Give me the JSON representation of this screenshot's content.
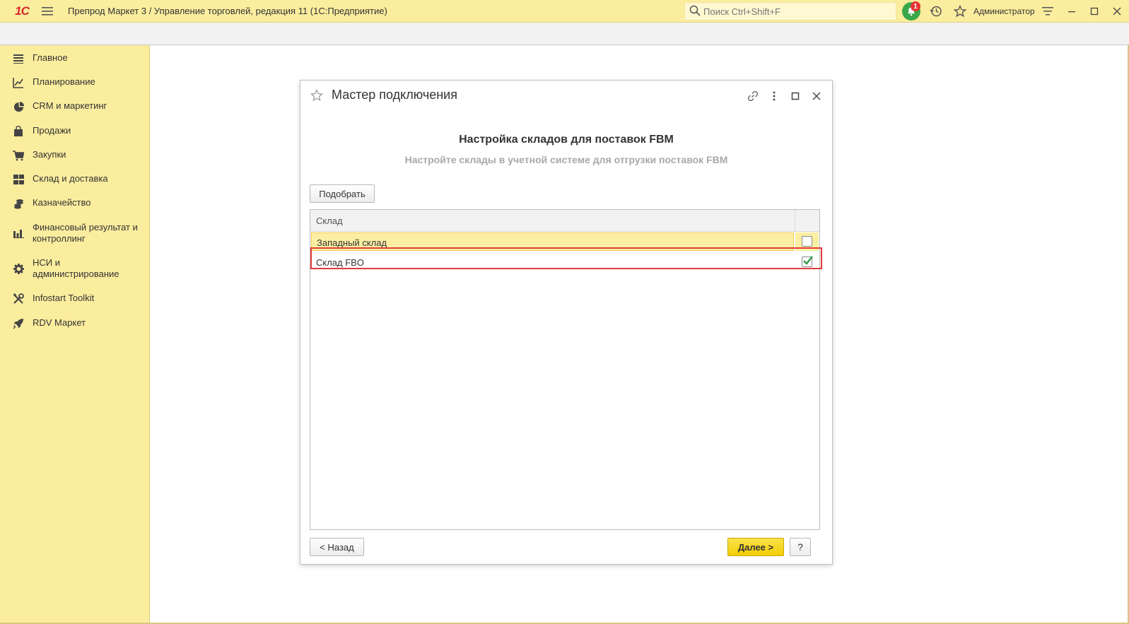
{
  "app": {
    "logo_text": "1C",
    "title": "Препрод Маркет 3 / Управление торговлей, редакция 11  (1С:Предприятие)",
    "search_placeholder": "Поиск Ctrl+Shift+F",
    "notification_count": "1",
    "user": "Администратор"
  },
  "sidebar": {
    "items": [
      {
        "label": "Главное",
        "icon": "list-icon"
      },
      {
        "label": "Планирование",
        "icon": "planning-icon"
      },
      {
        "label": "CRM и маркетинг",
        "icon": "pie-chart-icon"
      },
      {
        "label": "Продажи",
        "icon": "shopping-bag-icon"
      },
      {
        "label": "Закупки",
        "icon": "cart-icon"
      },
      {
        "label": "Склад и доставка",
        "icon": "warehouse-grid-icon"
      },
      {
        "label": "Казначейство",
        "icon": "coins-icon"
      },
      {
        "label": "Финансовый результат и\nконтроллинг",
        "icon": "bar-chart-icon"
      },
      {
        "label": "НСИ и\nадминистрирование",
        "icon": "gear-icon"
      },
      {
        "label": "Infostart Toolkit",
        "icon": "tools-icon"
      },
      {
        "label": "RDV Маркет",
        "icon": "rocket-icon"
      }
    ]
  },
  "dialog": {
    "title": "Мастер подключения",
    "step_title": "Настройка складов для поставок FBM",
    "step_subtitle": "Настройте склады в учетной системе для отгрузки поставок FBM",
    "pick_button": "Подобрать",
    "table": {
      "column_name": "Склад",
      "rows": [
        {
          "name": "Западный склад",
          "checked": false
        },
        {
          "name": "Склад FBO",
          "checked": true
        }
      ]
    },
    "back_button": "< Назад",
    "next_button": "Далее >",
    "help_button": "?"
  },
  "colors": {
    "accent_yellow": "#fbed9e",
    "highlight_red": "#e03b3b",
    "check_green": "#2e9a4a",
    "bell_green": "#3aa84a",
    "badge_red": "#e53434"
  }
}
